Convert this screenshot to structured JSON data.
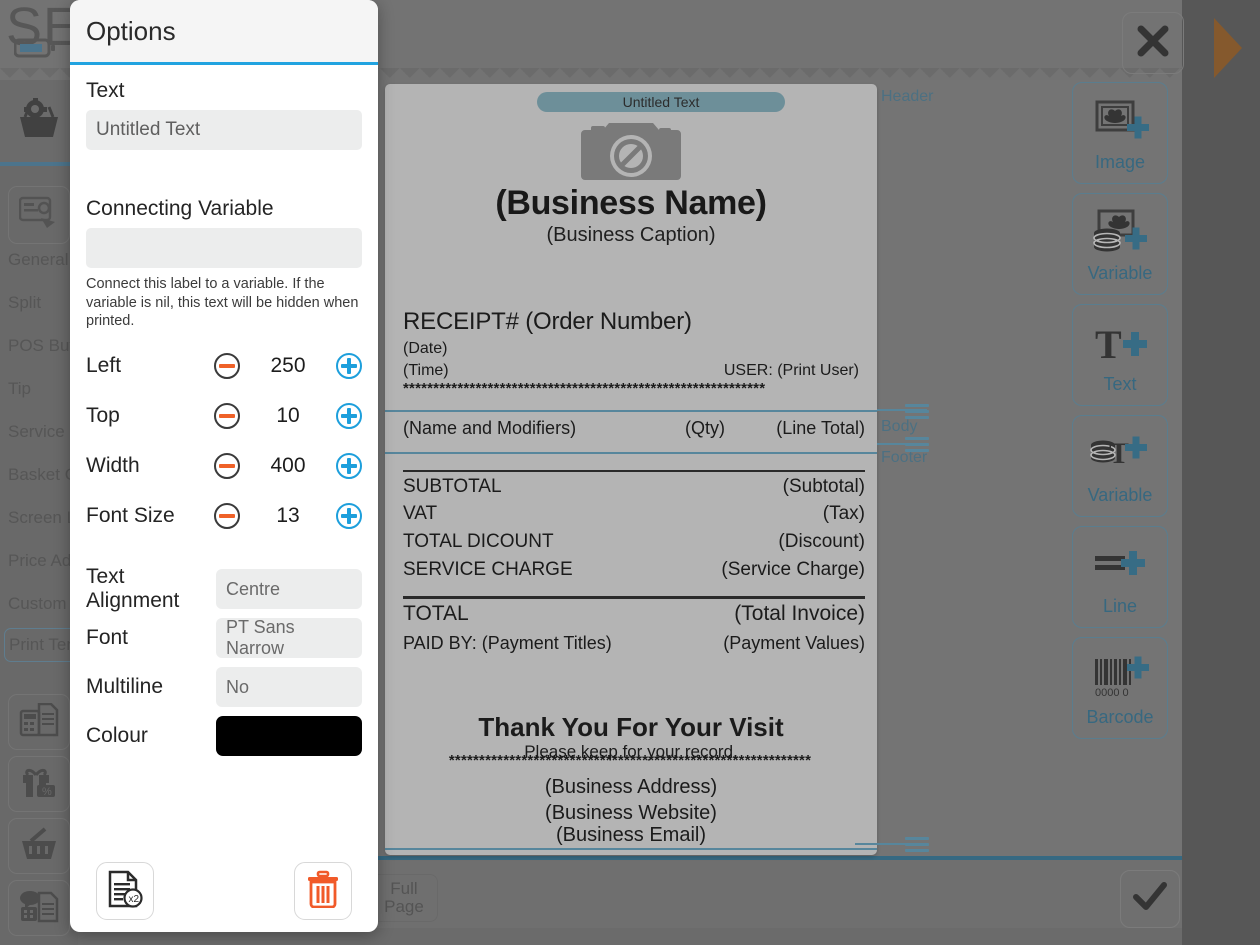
{
  "background": {
    "app_title": "SETTINGS",
    "menu_items": [
      {
        "label": "General",
        "selected": false
      },
      {
        "label": "Split",
        "selected": false
      },
      {
        "label": "POS Butt",
        "selected": false
      },
      {
        "label": "Tip",
        "selected": false
      },
      {
        "label": "Service C",
        "selected": false
      },
      {
        "label": "Basket G",
        "selected": false
      },
      {
        "label": "Screen L",
        "selected": false
      },
      {
        "label": "Price Adj",
        "selected": false
      },
      {
        "label": "Custom F",
        "selected": false
      },
      {
        "label": "Print Tem",
        "selected": true
      }
    ],
    "close_icon": "close-icon",
    "confirm_icon": "check-icon",
    "full_page_line1": "Full",
    "full_page_line2": "Page",
    "sidebar_top_icon": "basket-gear-icon",
    "sidebar_nav_icon": "card-touch-icon",
    "bottom_icons": [
      "calculator-document-icon",
      "gift-percent-icon",
      "basket-icon",
      "chat-receipt-icon"
    ]
  },
  "dialog": {
    "title": "Options",
    "accent_color": "#21a3e0",
    "text": {
      "label": "Text",
      "value": "Untitled Text"
    },
    "connecting_variable": {
      "label": "Connecting Variable",
      "value": "",
      "placeholder": "",
      "help": "Connect this label to a variable. If the variable is nil, this text will be hidden when printed."
    },
    "numeric_fields": [
      {
        "label": "Left",
        "value": "250"
      },
      {
        "label": "Top",
        "value": "10"
      },
      {
        "label": "Width",
        "value": "400"
      },
      {
        "label": "Font Size",
        "value": "13"
      }
    ],
    "select_fields": [
      {
        "label": "Text Alignment",
        "value": "Centre"
      },
      {
        "label": "Font",
        "value": "PT Sans Narrow"
      },
      {
        "label": "Multiline",
        "value": "No"
      }
    ],
    "colour": {
      "label": "Colour",
      "value": "#000000"
    },
    "footer": {
      "duplicate_icon": "duplicate-x2-icon",
      "delete_icon": "trash-icon",
      "minus_color": "#ef6128",
      "plus_color": "#1d9fdc",
      "trash_color": "#ef6128"
    }
  },
  "preview": {
    "selected_label": "Untitled Text",
    "selection_color": "#90c4d4",
    "guide_color": "#6fb7d8",
    "logo_placeholder_icon": "camera-no-image-icon",
    "business_name": "(Business Name)",
    "business_caption": "(Business Caption)",
    "receipt_heading": "RECEIPT# (Order Number)",
    "date": "(Date)",
    "time": "(Time)",
    "user": "USER: (Print User)",
    "divider_stars": "************************************************************",
    "line_item": {
      "name": "(Name and Modifiers)",
      "qty": "(Qty)",
      "total": "(Line Total)"
    },
    "totals": [
      {
        "label": "SUBTOTAL",
        "value": "(Subtotal)"
      },
      {
        "label": "VAT",
        "value": "(Tax)"
      },
      {
        "label": "TOTAL DICOUNT",
        "value": "(Discount)"
      },
      {
        "label": "SERVICE CHARGE",
        "value": "(Service Charge)"
      }
    ],
    "grand_total": {
      "label": "TOTAL",
      "value": "(Total Invoice)"
    },
    "paid_by": {
      "label": "PAID BY: (Payment Titles)",
      "value": "(Payment Values)"
    },
    "thanks": "Thank You For Your Visit",
    "thanks_sub": "Please keep for your record.",
    "address": "(Business Address)",
    "website": "(Business Website)",
    "email": "(Business Email)",
    "sections": {
      "header": "Header",
      "body": "Body",
      "footer": "Footer"
    }
  },
  "toolbar": {
    "buttons": [
      {
        "label": "Image",
        "icon": "image-add-icon"
      },
      {
        "label": "Variable",
        "icon": "image-variable-add-icon"
      },
      {
        "label": "Text",
        "icon": "text-add-icon"
      },
      {
        "label": "Variable",
        "icon": "text-variable-add-icon"
      },
      {
        "label": "Line",
        "icon": "line-add-icon"
      },
      {
        "label": "Barcode",
        "icon": "barcode-add-icon"
      }
    ],
    "accent_color": "#3f89ad"
  }
}
